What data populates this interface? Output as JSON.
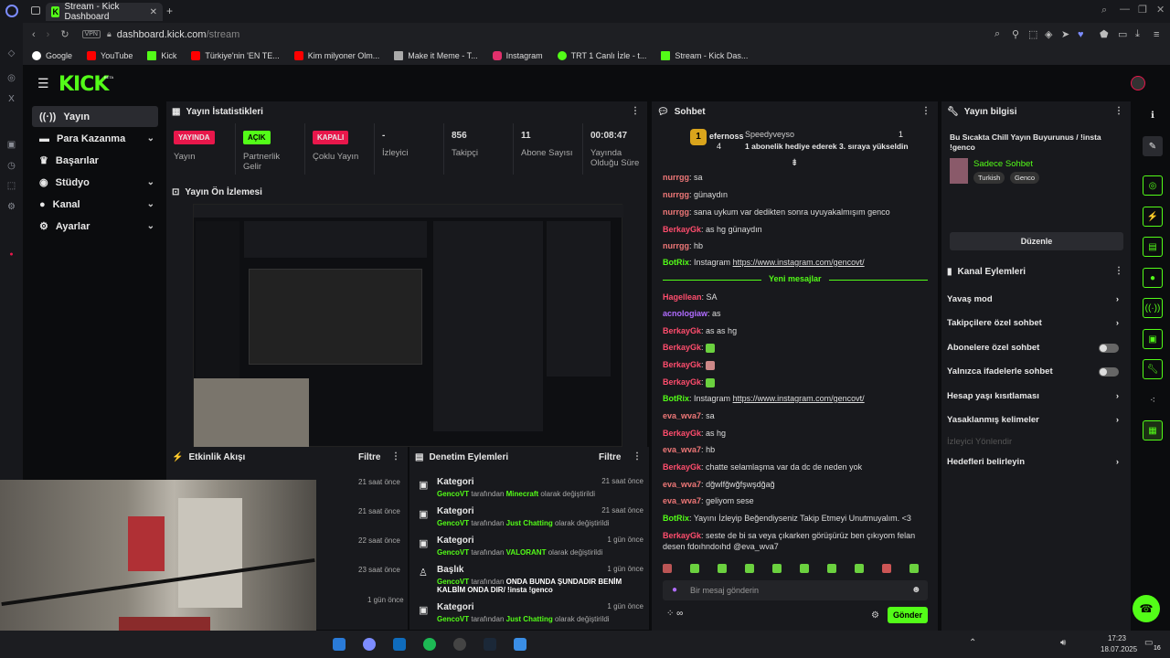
{
  "browser": {
    "tab_title": "Stream - Kick Dashboard",
    "url_domain": "dashboard.kick.com",
    "url_path": "/stream",
    "vpn": "VPN",
    "bookmarks": [
      "Google",
      "YouTube",
      "Kick",
      "Türkiye'nin 'EN TE...",
      "Kim milyoner Olm...",
      "Make it Meme - T...",
      "Instagram",
      "TRT 1 Canlı İzle - t...",
      "Stream - Kick Das..."
    ]
  },
  "app": {
    "logo": "KICK",
    "beta": "BETA",
    "nav": [
      {
        "label": "Yayın",
        "chev": ""
      },
      {
        "label": "Para Kazanma",
        "chev": "⌄"
      },
      {
        "label": "Başarılar",
        "chev": ""
      },
      {
        "label": "Stüdyo",
        "chev": "⌄"
      },
      {
        "label": "Kanal",
        "chev": "⌄"
      },
      {
        "label": "Ayarlar",
        "chev": "⌄"
      }
    ]
  },
  "stats": {
    "title": "Yayın İstatistikleri",
    "cells": [
      {
        "badge": "YAYINDA",
        "label": "Yayın"
      },
      {
        "badge": "AÇIK",
        "label": "Partnerlik Gelir"
      },
      {
        "badge": "KAPALI",
        "label": "Çoklu Yayın"
      },
      {
        "value": "-",
        "label": "İzleyici"
      },
      {
        "value": "856",
        "label": "Takipçi"
      },
      {
        "value": "11",
        "label": "Abone Sayısı"
      },
      {
        "value": "00:08:47",
        "label": "Yayında Olduğu Süre"
      }
    ]
  },
  "preview": {
    "title": "Yayın Ön İzlemesi"
  },
  "activity": {
    "title": "Etkinlik Akışı",
    "filter": "Filtre",
    "times": [
      "21 saat önce",
      "21 saat önce",
      "22 saat önce",
      "23 saat önce",
      "1 gün önce"
    ]
  },
  "moderation": {
    "title": "Denetim Eylemleri",
    "filter": "Filtre",
    "items": [
      {
        "title": "Kategori",
        "user": "GencoVT",
        "mid": "tarafından",
        "value": "Minecraft",
        "end": "olarak değiştirildi",
        "time": "21 saat önce"
      },
      {
        "title": "Kategori",
        "user": "GencoVT",
        "mid": "tarafından",
        "value": "Just Chatting",
        "end": "olarak değiştirildi",
        "time": "21 saat önce"
      },
      {
        "title": "Kategori",
        "user": "GencoVT",
        "mid": "tarafından",
        "value": "VALORANT",
        "end": "olarak değiştirildi",
        "time": "1 gün önce"
      },
      {
        "title": "Başlık",
        "user": "GencoVT",
        "mid": "tarafından",
        "value": "ONDA BUNDA ŞUNDADIR BENİM KALBİM ONDA DIR/ !insta !genco",
        "end": "",
        "time": "1 gün önce"
      },
      {
        "title": "Kategori",
        "user": "GencoVT",
        "mid": "tarafından",
        "value": "Just Chatting",
        "end": "olarak değiştirildi",
        "time": "1 gün önce"
      }
    ]
  },
  "chat": {
    "title": "Sohbet",
    "top_user": "efernoss",
    "top_count": "4",
    "gift_user": "Speedyveyso",
    "gift_count": "1",
    "gift_text": "1 abonelik hediye ederek 3. sıraya yükseldin",
    "new_messages": "Yeni mesajlar",
    "messages": [
      {
        "user": "nurrgg",
        "text": "sa"
      },
      {
        "user": "nurrgg",
        "text": "günaydın"
      },
      {
        "user": "nurrgg",
        "text": "sana uykum var dedikten sonra uyuyakalmışım genco"
      },
      {
        "user": "BerkayGk",
        "text": "as hg günaydın"
      },
      {
        "user": "nurrgg",
        "text": "hb"
      },
      {
        "user": "BotRix",
        "text": "Instagram",
        "link": "https://www.instagram.com/gencovt/"
      },
      {
        "user": "Hagellean",
        "text": "SA"
      },
      {
        "user": "acnologiaw",
        "text": "as"
      },
      {
        "user": "BerkayGk",
        "text": "as as hg"
      },
      {
        "user": "BerkayGk",
        "text": ""
      },
      {
        "user": "BerkayGk",
        "text": ""
      },
      {
        "user": "BerkayGk",
        "text": ""
      },
      {
        "user": "BotRix",
        "text": "Instagram",
        "link": "https://www.instagram.com/gencovt/"
      },
      {
        "user": "eva_wva7",
        "text": "sa"
      },
      {
        "user": "BerkayGk",
        "text": "as hg"
      },
      {
        "user": "eva_wva7",
        "text": "hb"
      },
      {
        "user": "BerkayGk",
        "text": "chatte selamlaşma var da dc de neden yok"
      },
      {
        "user": "eva_wva7",
        "text": "dğwlfğwğfşwşdğağ"
      },
      {
        "user": "eva_wva7",
        "text": "geliyom sese"
      },
      {
        "user": "BotRix",
        "text": "Yayını İzleyip Beğendiyseniz Takip Etmeyi Unutmuyalım. <3"
      },
      {
        "user": "BerkayGk",
        "text": "seste de bi sa veya çıkarken görüşürüz ben çıkıyom felan"
      },
      {
        "user": "",
        "text": "desen fdoıhndoıhd @eva_wva7"
      }
    ],
    "input_placeholder": "Bir mesaj gönderin",
    "send": "Gönder"
  },
  "info": {
    "title": "Yayın bilgisi",
    "stream_title": "Bu Sıcakta Chill Yayın Buyurunus / !insta !genco",
    "category": "Sadece Sohbet",
    "tags": [
      "Turkish",
      "Genco"
    ],
    "edit": "Düzenle"
  },
  "channel": {
    "title": "Kanal Eylemleri",
    "rows": [
      {
        "label": "Yavaş mod",
        "control": "›"
      },
      {
        "label": "Takipçilere özel sohbet",
        "control": "›"
      },
      {
        "label": "Abonelere özel sohbet",
        "control": "toggle"
      },
      {
        "label": "Yalnızca ifadelerle sohbet",
        "control": "toggle"
      },
      {
        "label": "Hesap yaşı kısıtlaması",
        "control": "›"
      },
      {
        "label": "Yasaklanmış kelimeler",
        "control": "›"
      },
      {
        "label": "İzleyici Yönlendir",
        "control": ""
      },
      {
        "label": "Hedefleri belirleyin",
        "control": "›"
      }
    ]
  },
  "taskbar": {
    "time": "17:23",
    "date": "18.07.2025",
    "notif": "16"
  },
  "colors": {
    "accent": "#53fc18",
    "live": "#e8174b",
    "bg": "#0b0c0e",
    "panel": "#18191d"
  }
}
